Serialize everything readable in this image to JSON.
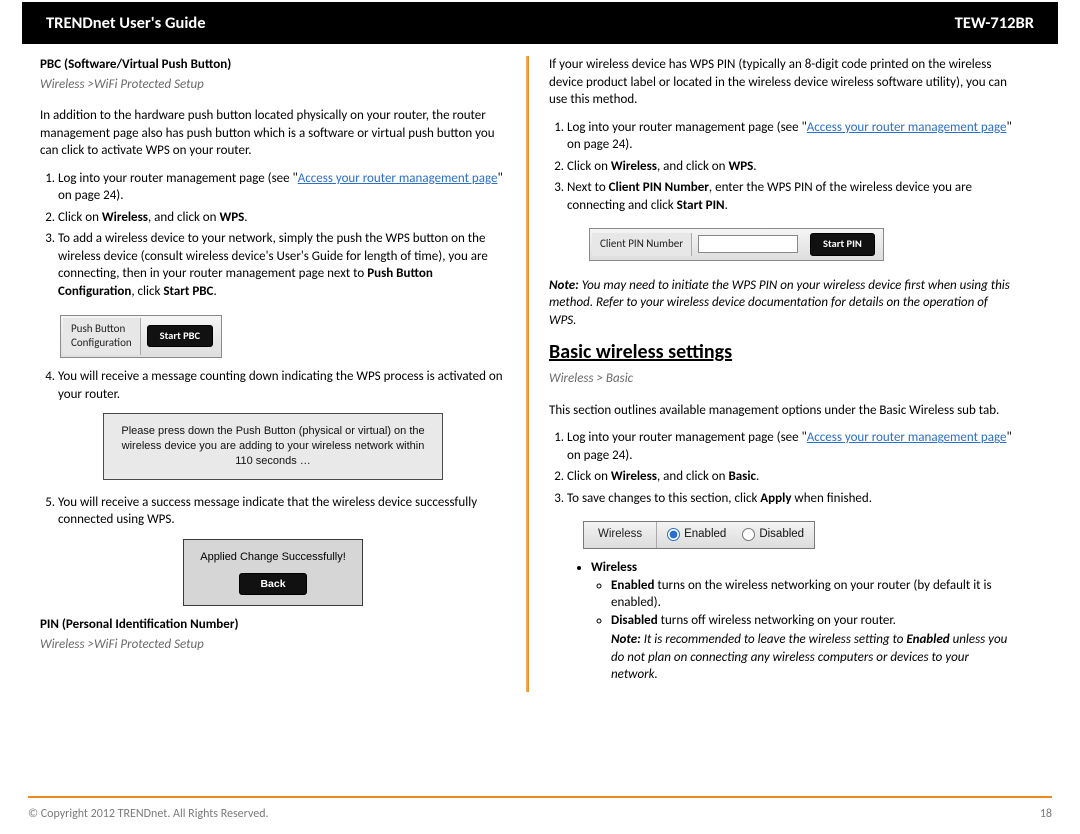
{
  "header": {
    "left": "TRENDnet User's Guide",
    "right": "TEW-712BR"
  },
  "left": {
    "pbc": {
      "title": "PBC (Software/Virtual Push Button)",
      "breadcrumb": "Wireless >WiFi Protected Setup",
      "intro": "In addition to the hardware push button located physically on your router, the router management page also has push button which is a software or virtual push button you can click to activate WPS on your router.",
      "step1a": "Log into your router management page (see \"",
      "step1link": "Access your router management page",
      "step1b": "\" on page 24).",
      "step2a": "Click on ",
      "step2b": "Wireless",
      "step2c": ", and click on ",
      "step2d": "WPS",
      "step2e": ".",
      "step3a": "To add a wireless device to your network, simply the push the WPS button on the wireless device (consult wireless device's User's Guide for length of time), you are connecting, then in your router management page next to ",
      "step3b": "Push Button Configuration",
      "step3c": ", click ",
      "step3d": "Start PBC",
      "step3e": ".",
      "ui": {
        "label": "Push Button\nConfiguration",
        "btn": "Start PBC"
      },
      "step4": "You will receive a message counting down indicating the WPS process is activated on your router.",
      "msg": "Please press down the Push Button (physical or virtual) on the wireless device you are adding to your wireless network within 110 seconds …",
      "step5": "You will receive a success message indicate that the wireless device successfully connected using WPS.",
      "success": {
        "msg": "Applied Change Successfully!",
        "btn": "Back"
      },
      "pin": {
        "title": "PIN (Personal Identification Number)",
        "breadcrumb": "Wireless >WiFi Protected Setup"
      }
    }
  },
  "right": {
    "pinintro": "If your wireless device has WPS PIN (typically an 8-digit code printed on the wireless device product label or located in the wireless device wireless software utility), you can use this method.",
    "step1a": "Log into your router management page (see \"",
    "step1link": "Access your router management page",
    "step1b": "\" on page 24).",
    "step2a": "Click on ",
    "step2b": "Wireless",
    "step2c": ", and click on ",
    "step2d": "WPS",
    "step2e": ".",
    "step3a": "Next to ",
    "step3b": "Client PIN Number",
    "step3c": ", enter the WPS PIN of the wireless device you are connecting and click ",
    "step3d": "Start PIN",
    "step3e": ".",
    "pinui": {
      "label": "Client PIN Number",
      "btn": "Start PIN"
    },
    "note": "Note: You may need to initiate the WPS PIN on your wireless device first when using this method. Refer to your wireless device documentation for details on the operation of WPS.",
    "basic": {
      "heading": "Basic wireless settings",
      "breadcrumb": "Wireless > Basic",
      "intro": "This section outlines available management options under the Basic Wireless sub tab.",
      "step1a": "Log into your router management page (see \"",
      "step1link": "Access your router management page",
      "step1b": "\" on page 24).",
      "step2a": "Click on ",
      "step2b": "Wireless",
      "step2c": ", and click on ",
      "step2d": "Basic",
      "step2e": ".",
      "step3a": "To save changes to this section, click ",
      "step3b": "Apply",
      "step3c": " when finished.",
      "toggle": {
        "label": "Wireless",
        "opt1": "Enabled",
        "opt2": "Disabled"
      },
      "bullets": {
        "wireless": "Wireless",
        "enabled_b": "Enabled",
        "enabled_t": " turns on the wireless networking on your router (by default it is enabled).",
        "disabled_b": "Disabled",
        "disabled_t": " turns off wireless networking on your router.",
        "note_b": "Note:",
        "note_t": " It is recommended to leave the wireless setting to ",
        "note_e": "Enabled",
        "note_tail": " unless you do not plan on connecting any wireless computers or devices to your network."
      }
    }
  },
  "footer": {
    "copyright": "© Copyright 2012 TRENDnet. All Rights Reserved.",
    "page": "18"
  }
}
